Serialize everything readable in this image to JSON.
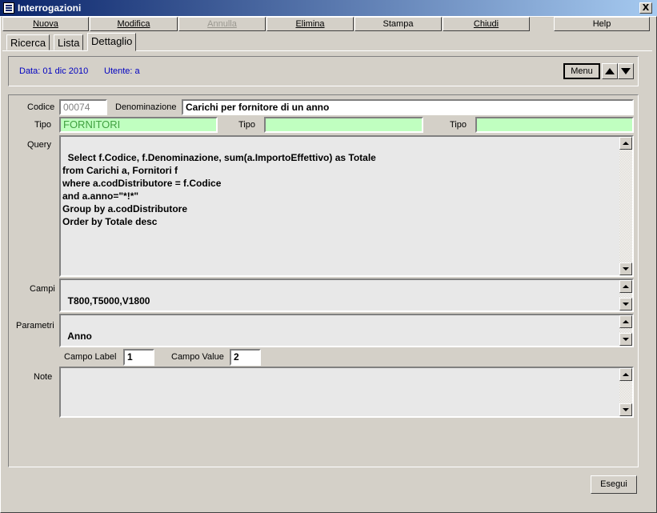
{
  "window": {
    "title": "Interrogazioni",
    "close_label": "X"
  },
  "toolbar": {
    "nuova": "Nuova",
    "modifica": "Modifica",
    "annulla": "Annulla",
    "elimina": "Elimina",
    "stampa": "Stampa",
    "chiudi": "Chiudi",
    "help": "Help"
  },
  "tabs": [
    "Ricerca",
    "Lista",
    "Dettaglio"
  ],
  "header": {
    "date": "Data: 01 dic 2010",
    "user": "Utente: a",
    "menu_label": "Menu"
  },
  "form": {
    "codice_label": "Codice",
    "codice": "00074",
    "denominazione_label": "Denominazione",
    "denominazione": "Carichi per fornitore di un anno",
    "tipo_label": "Tipo",
    "tipo1": "FORNITORI",
    "tipo2": "",
    "tipo3": "",
    "query_label": "Query",
    "query": "Select f.Codice, f.Denominazione, sum(a.ImportoEffettivo) as Totale\nfrom Carichi a, Fornitori f\nwhere a.codDistributore = f.Codice\nand a.anno=\"*!*\"\nGroup by a.codDistributore\nOrder by Totale desc",
    "campi_label": "Campi",
    "campi": "T800,T5000,V1800",
    "parametri_label": "Parametri",
    "parametri": "Anno",
    "campo_label_label": "Campo Label",
    "campo_label": "1",
    "campo_value_label": "Campo Value",
    "campo_value": "2",
    "note_label": "Note",
    "note": ""
  },
  "footer": {
    "esegui": "Esegui"
  }
}
